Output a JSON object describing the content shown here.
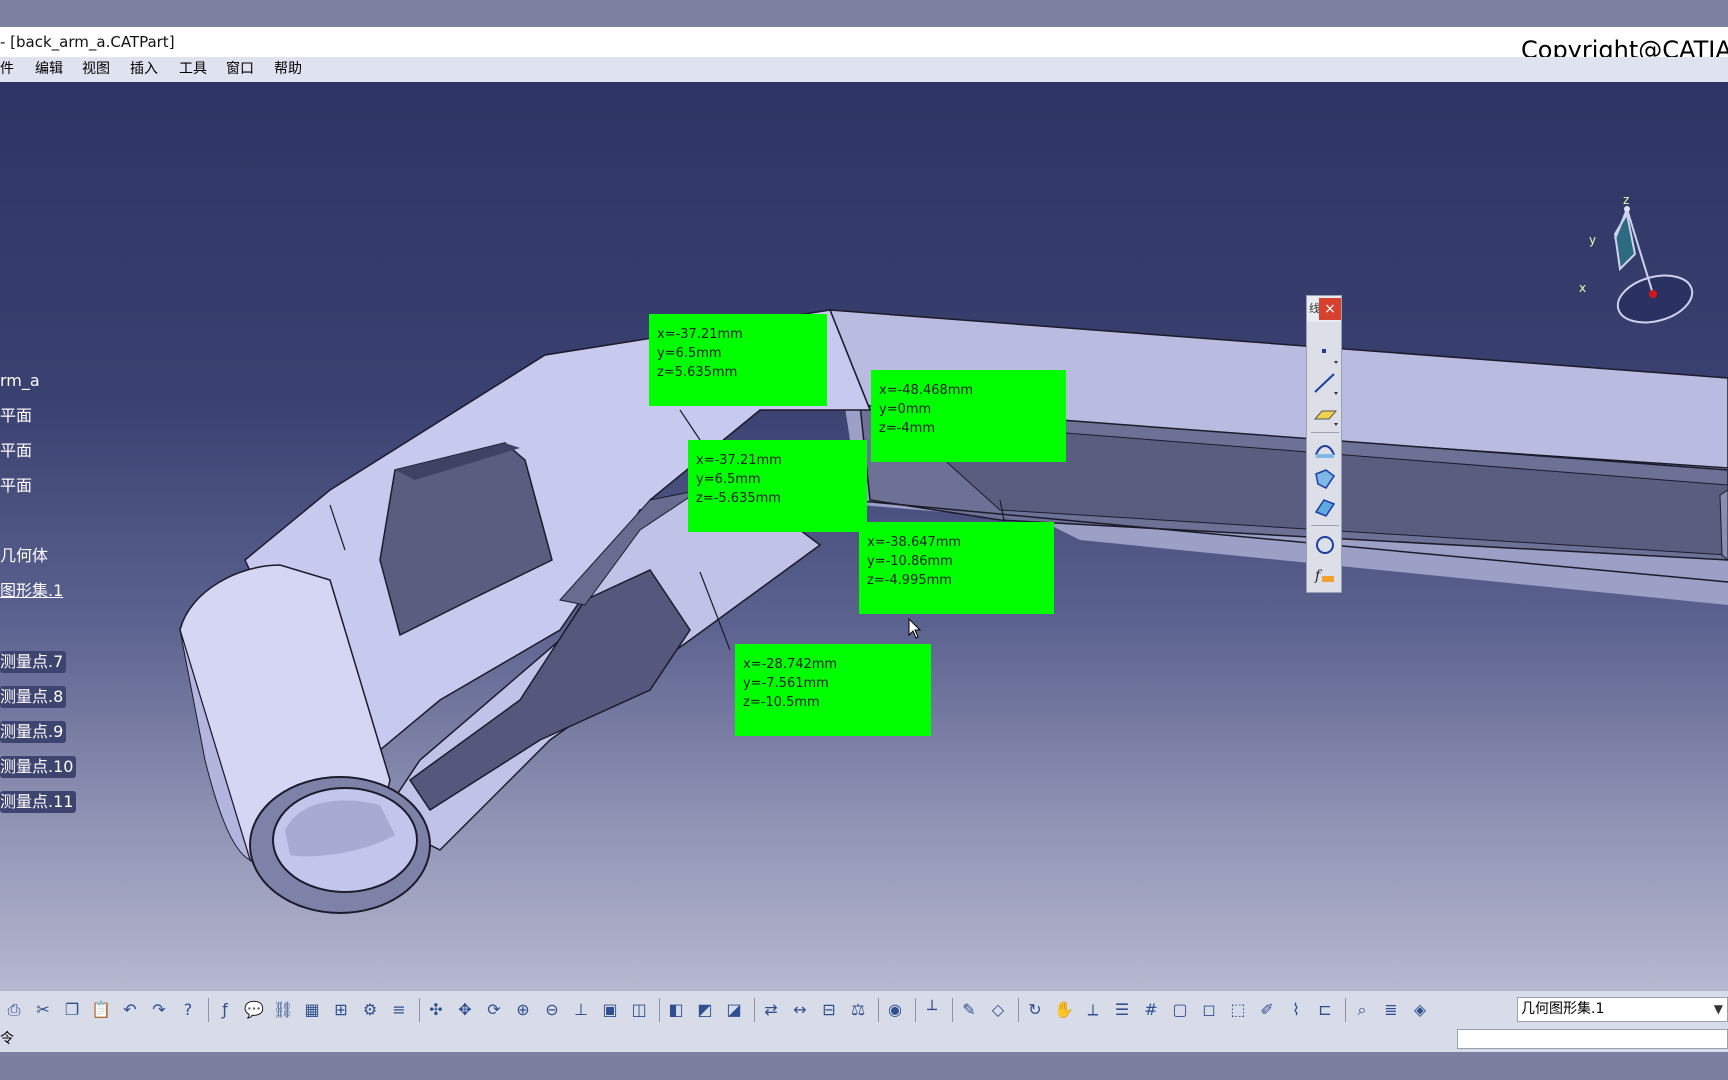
{
  "window": {
    "title": "- [back_arm_a.CATPart]",
    "copyright": "Copyright@CATIA"
  },
  "menu": [
    "件",
    "编辑",
    "视图",
    "插入",
    "工具",
    "窗口",
    "帮助"
  ],
  "tree": {
    "items": [
      {
        "label": "rm_a"
      },
      {
        "label": "平面"
      },
      {
        "label": "平面"
      },
      {
        "label": "平面"
      },
      {
        "label": "几何体"
      },
      {
        "label": "图形集.1"
      },
      {
        "label": "测量点.7"
      },
      {
        "label": "测量点.8"
      },
      {
        "label": "测量点.9"
      },
      {
        "label": "测量点.10"
      },
      {
        "label": "测量点.11"
      }
    ]
  },
  "measurements": [
    {
      "x": "x=-37.21mm",
      "y": "y=6.5mm",
      "z": "z=5.635mm"
    },
    {
      "x": "x=-48.468mm",
      "y": "y=0mm",
      "z": "z=-4mm"
    },
    {
      "x": "x=-37.21mm",
      "y": "y=6.5mm",
      "z": "z=-5.635mm"
    },
    {
      "x": "x=-38.647mm",
      "y": "y=-10.86mm",
      "z": "z=-4.995mm"
    },
    {
      "x": "x=-28.742mm",
      "y": "y=-7.561mm",
      "z": "z=-10.5mm"
    }
  ],
  "compass": {
    "x_label": "x",
    "y_label": "y",
    "z_label": "z"
  },
  "floating_toolbar": {
    "grip": "线",
    "close": "×",
    "icons": [
      "point-icon",
      "line-icon",
      "plane-icon",
      "projection-icon",
      "intersection-icon",
      "surface-icon",
      "circle-icon",
      "formula-icon"
    ]
  },
  "bottom_toolbar": {
    "icons": [
      "print-icon",
      "cut-icon",
      "copy-icon",
      "paste-icon",
      "undo-icon",
      "redo-icon",
      "help-icon",
      "formula-icon",
      "comment-icon",
      "link-icon",
      "table-icon",
      "tree-icon",
      "parameter-icon",
      "filter-icon",
      "fit-all-icon",
      "pan-icon",
      "rotate-icon",
      "zoom-in-icon",
      "zoom-out-icon",
      "normal-view-icon",
      "quick-view-icon",
      "iso-view-icon",
      "shading-icon",
      "render-icon",
      "hide-show-icon",
      "swap-icon",
      "measure-between-icon",
      "measure-item-icon",
      "mass-icon",
      "camera-icon",
      "axis-icon",
      "sketch-icon",
      "geometry-icon",
      "update-icon",
      "hand-icon",
      "axes-icon",
      "list-icon",
      "grid-icon",
      "cube-icon",
      "box-icon",
      "frame-icon",
      "edit-icon",
      "brush-icon",
      "align-icon",
      "search-icon",
      "layers-icon",
      "part-icon"
    ],
    "geo_set_value": "几何图形集.1"
  },
  "status": {
    "label": "令"
  }
}
